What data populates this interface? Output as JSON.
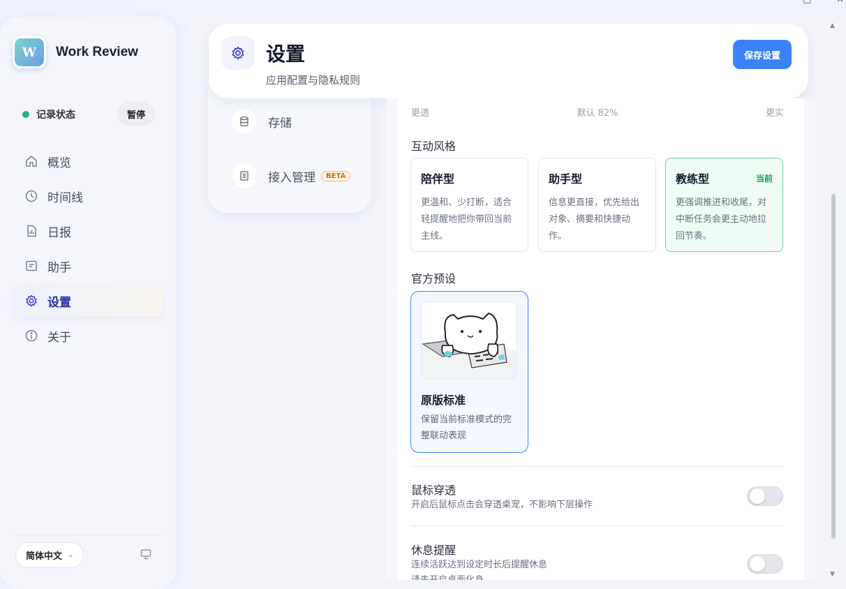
{
  "app": {
    "name": "Work Review",
    "logo_glyph": "W"
  },
  "recording": {
    "label": "记录状态",
    "button": "暂停",
    "status_color": "#22b37a"
  },
  "nav": {
    "items": [
      {
        "label": "概览",
        "icon": "home-icon"
      },
      {
        "label": "时间线",
        "icon": "clock-icon"
      },
      {
        "label": "日报",
        "icon": "report-icon"
      },
      {
        "label": "助手",
        "icon": "assistant-icon"
      },
      {
        "label": "设置",
        "icon": "gear-icon",
        "active": true
      },
      {
        "label": "关于",
        "icon": "info-icon"
      }
    ]
  },
  "footer": {
    "language": "简体中文"
  },
  "subnav": {
    "items": [
      {
        "label": "存储",
        "icon": "database-icon"
      },
      {
        "label": "接入管理",
        "icon": "server-icon",
        "badge": "BETA"
      }
    ]
  },
  "header": {
    "title": "设置",
    "subtitle": "应用配置与隐私规则",
    "save_label": "保存设置",
    "accent": "#3b82f6"
  },
  "opacity": {
    "left": "更透",
    "middle": "默认 82%",
    "right": "更实"
  },
  "interaction_style": {
    "label": "互动风格",
    "cards": [
      {
        "title": "陪伴型",
        "desc": "更温和、少打断，适合轻提醒地把你带回当前主线。",
        "current": false
      },
      {
        "title": "助手型",
        "desc": "信息更直接，优先给出对象、摘要和快捷动作。",
        "current": false
      },
      {
        "title": "教练型",
        "desc": "更强调推进和收尾，对中断任务会更主动地拉回节奏。",
        "current": true,
        "tag": "当前"
      }
    ]
  },
  "presets": {
    "label": "官方预设",
    "card": {
      "name": "原版标准",
      "desc": "保留当前标准模式的完整联动表现"
    }
  },
  "options": {
    "mouse_through": {
      "title": "鼠标穿透",
      "desc": "开启后鼠标点击会穿透桌宠，不影响下层操作",
      "enabled": false
    },
    "rest_reminder": {
      "title": "休息提醒",
      "desc": "连续活跃达到设定时长后提醒休息",
      "desc2": "请先开启桌面化身",
      "enabled": false
    }
  }
}
